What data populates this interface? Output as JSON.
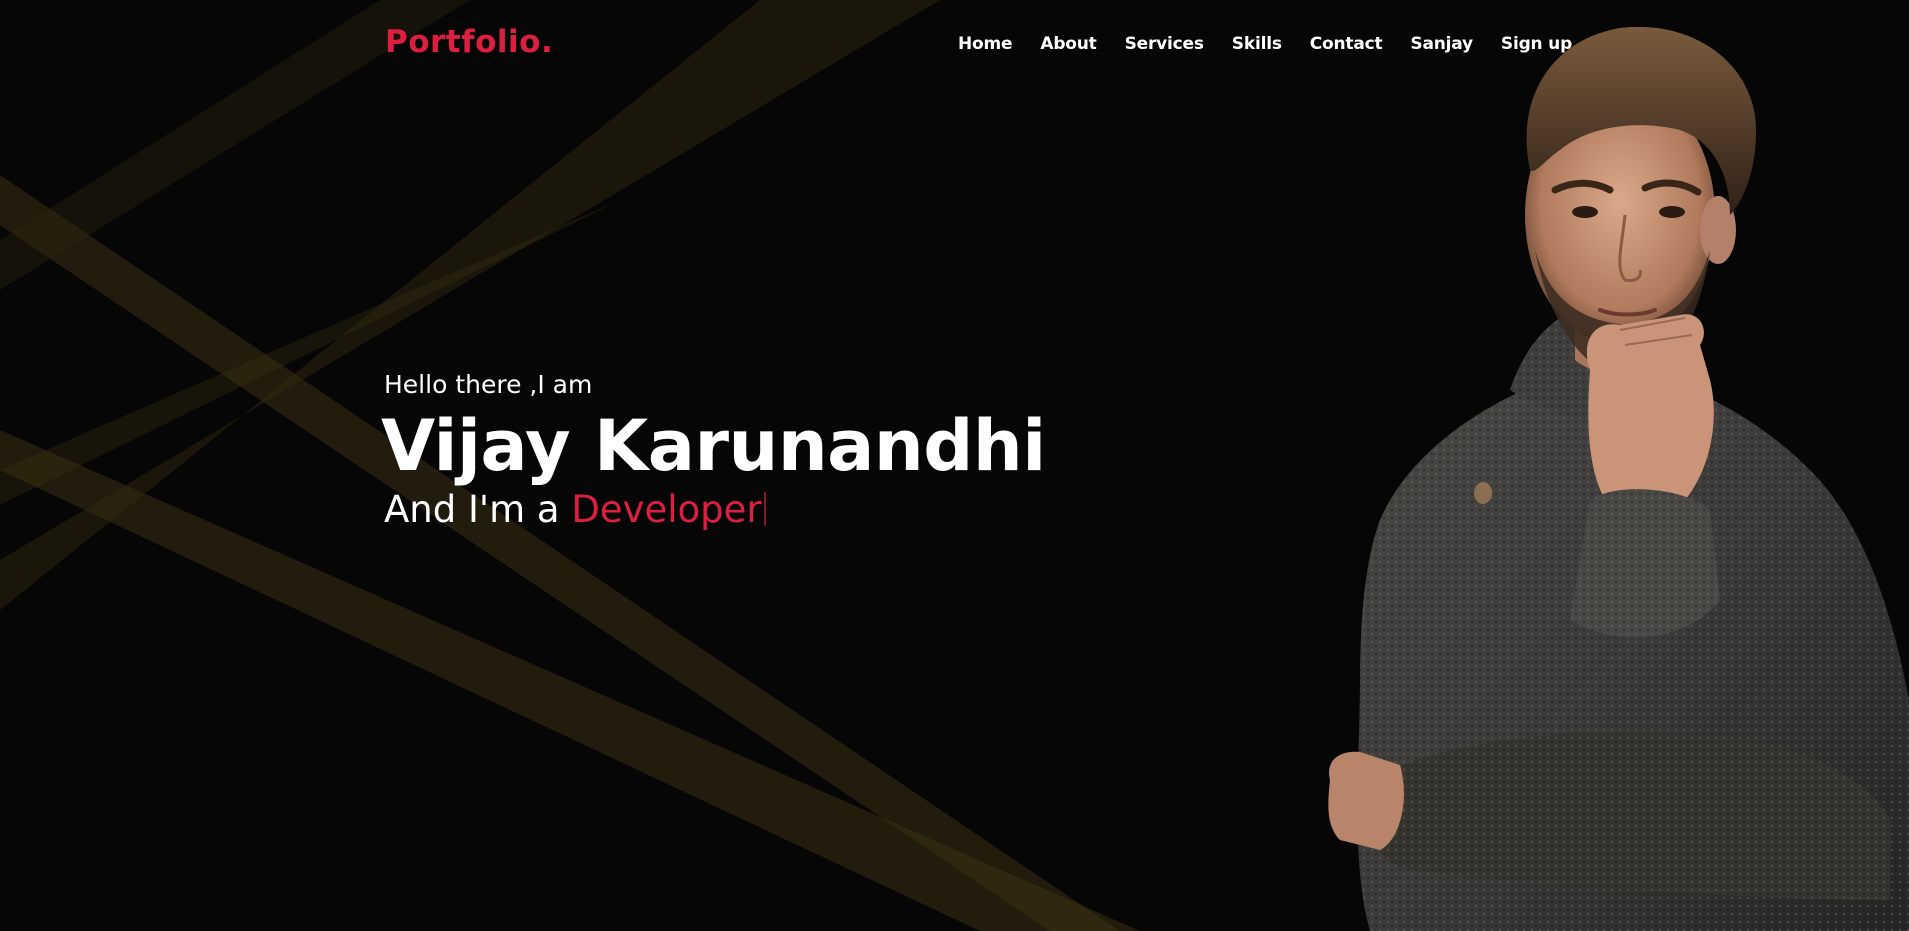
{
  "navbar": {
    "logo_text": "Portfolio",
    "logo_dot": ".",
    "links": [
      "Home",
      "About",
      "Services",
      "Skills",
      "Contact",
      "Sanjay",
      "Sign up"
    ]
  },
  "hero": {
    "greeting": "Hello there ,I am",
    "name": "Vijay Karunandhi",
    "role_prefix": "And I'm a ",
    "role_word": "Developer"
  },
  "colors": {
    "background": "#060606",
    "accent": "#dc1f40",
    "text": "#ffffff",
    "rays": "#5a4a1a"
  },
  "icons": {
    "portrait": "man-in-sweater-photo"
  }
}
